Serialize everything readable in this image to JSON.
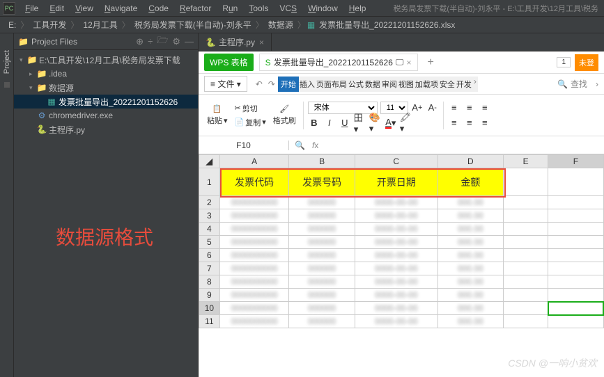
{
  "menubar": {
    "items": [
      "File",
      "Edit",
      "View",
      "Navigate",
      "Code",
      "Refactor",
      "Run",
      "Tools",
      "VCS",
      "Window",
      "Help"
    ],
    "right_title": "税务局发票下载(半自动)-刘永平 - E:\\工具开发\\12月工具\\税务"
  },
  "breadcrumb": {
    "drive": "E:",
    "parts": [
      "工具开发",
      "12月工具",
      "税务局发票下载(半自动)-刘永平",
      "数据源"
    ],
    "file": "发票批量导出_20221201152626.xlsx"
  },
  "project_panel": {
    "title": "Project Files",
    "tree": {
      "root": "E:\\工具开发\\12月工具\\税务局发票下载",
      "idea": ".idea",
      "datasource": "数据源",
      "export_file": "发票批量导出_20221201152626",
      "chromedriver": "chromedriver.exe",
      "main_py": "主程序.py"
    }
  },
  "side_tab": "Project",
  "editor_tab": {
    "label": "主程序.py"
  },
  "annotation": "数据源格式",
  "wps": {
    "badge": "WPS 表格",
    "doc_tab": "发票批量导出_20221201152626",
    "page_num": "1",
    "login": "未登",
    "file_menu": "文件",
    "ribbon": [
      "开始",
      "插入",
      "页面布局",
      "公式",
      "数据",
      "审阅",
      "视图",
      "加载项",
      "安全",
      "开发"
    ],
    "search": "查找",
    "toolbar": {
      "cut": "剪切",
      "copy": "复制",
      "paste": "粘贴",
      "format_painter": "格式刷",
      "font": "宋体",
      "font_size": "11"
    },
    "cell_ref": "F10",
    "columns": [
      "A",
      "B",
      "C",
      "D",
      "E",
      "F"
    ],
    "headers": [
      "发票代码",
      "发票号码",
      "开票日期",
      "金额"
    ],
    "row_count": 11
  },
  "watermark": "CSDN @一响小贫欢"
}
